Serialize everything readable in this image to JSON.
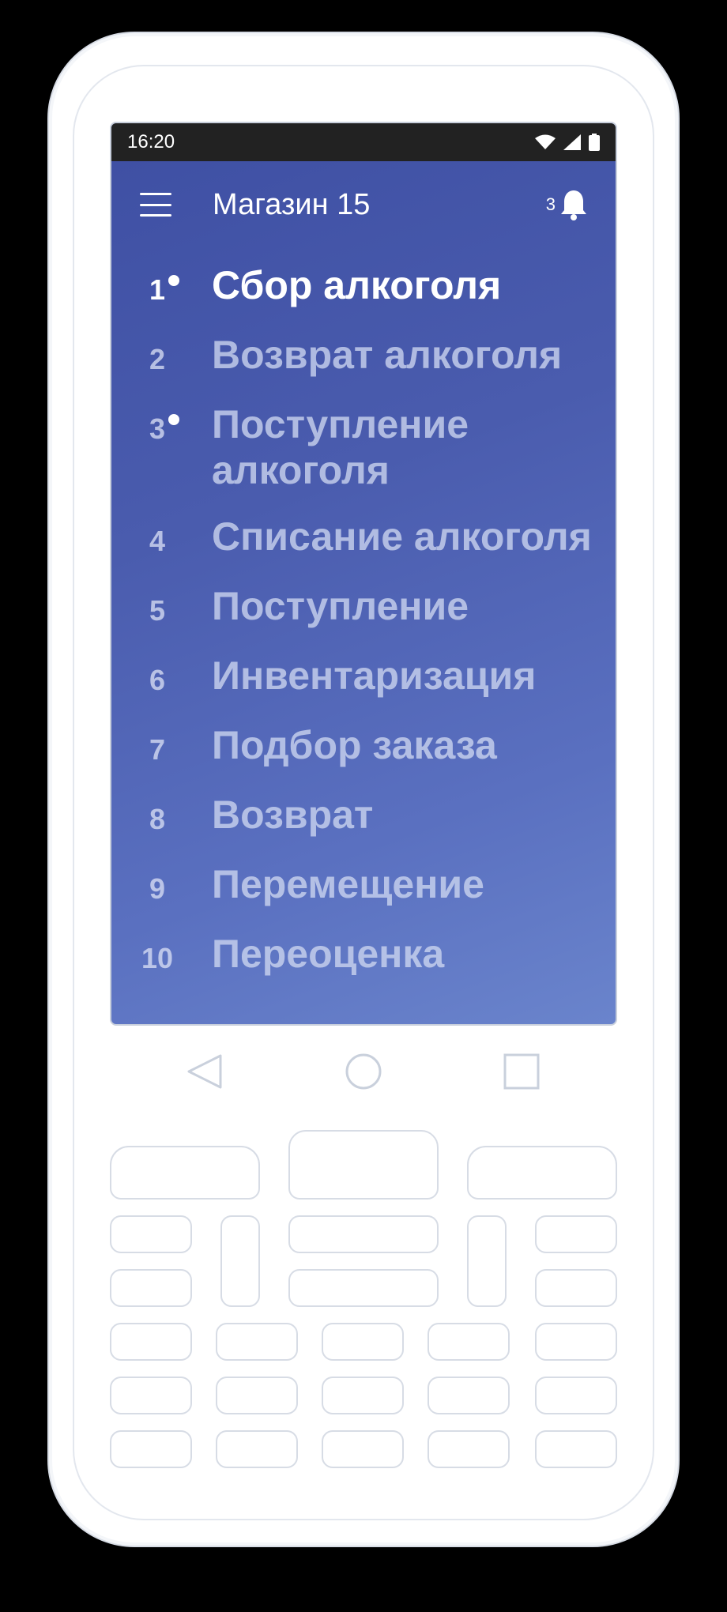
{
  "status_bar": {
    "time": "16:20",
    "icons": [
      "wifi-icon",
      "signal-icon",
      "battery-icon"
    ]
  },
  "app_bar": {
    "title": "Магазин 15",
    "notification_count": "3",
    "icons": [
      "menu-icon",
      "bell-icon"
    ]
  },
  "menu": {
    "items": [
      {
        "number": "1",
        "label": "Сбор алкоголя",
        "active": true,
        "has_dot": true
      },
      {
        "number": "2",
        "label": "Возврат алкоголя",
        "active": false,
        "has_dot": false
      },
      {
        "number": "3",
        "label": "Поступление алкоголя",
        "active": false,
        "has_dot": true
      },
      {
        "number": "4",
        "label": "Списание алкоголя",
        "active": false,
        "has_dot": false
      },
      {
        "number": "5",
        "label": "Поступление",
        "active": false,
        "has_dot": false
      },
      {
        "number": "6",
        "label": "Инвентаризация",
        "active": false,
        "has_dot": false
      },
      {
        "number": "7",
        "label": "Подбор заказа",
        "active": false,
        "has_dot": false
      },
      {
        "number": "8",
        "label": "Возврат",
        "active": false,
        "has_dot": false
      },
      {
        "number": "9",
        "label": "Перемещение",
        "active": false,
        "has_dot": false
      },
      {
        "number": "10",
        "label": "Переоценка",
        "active": false,
        "has_dot": false
      }
    ]
  },
  "nav_bar": {
    "icons": [
      "back-icon",
      "home-icon",
      "recents-icon"
    ]
  },
  "colors": {
    "screen_gradient_start": "#3e4fa3",
    "screen_gradient_end": "#6a84cc",
    "status_bar": "#222222"
  }
}
